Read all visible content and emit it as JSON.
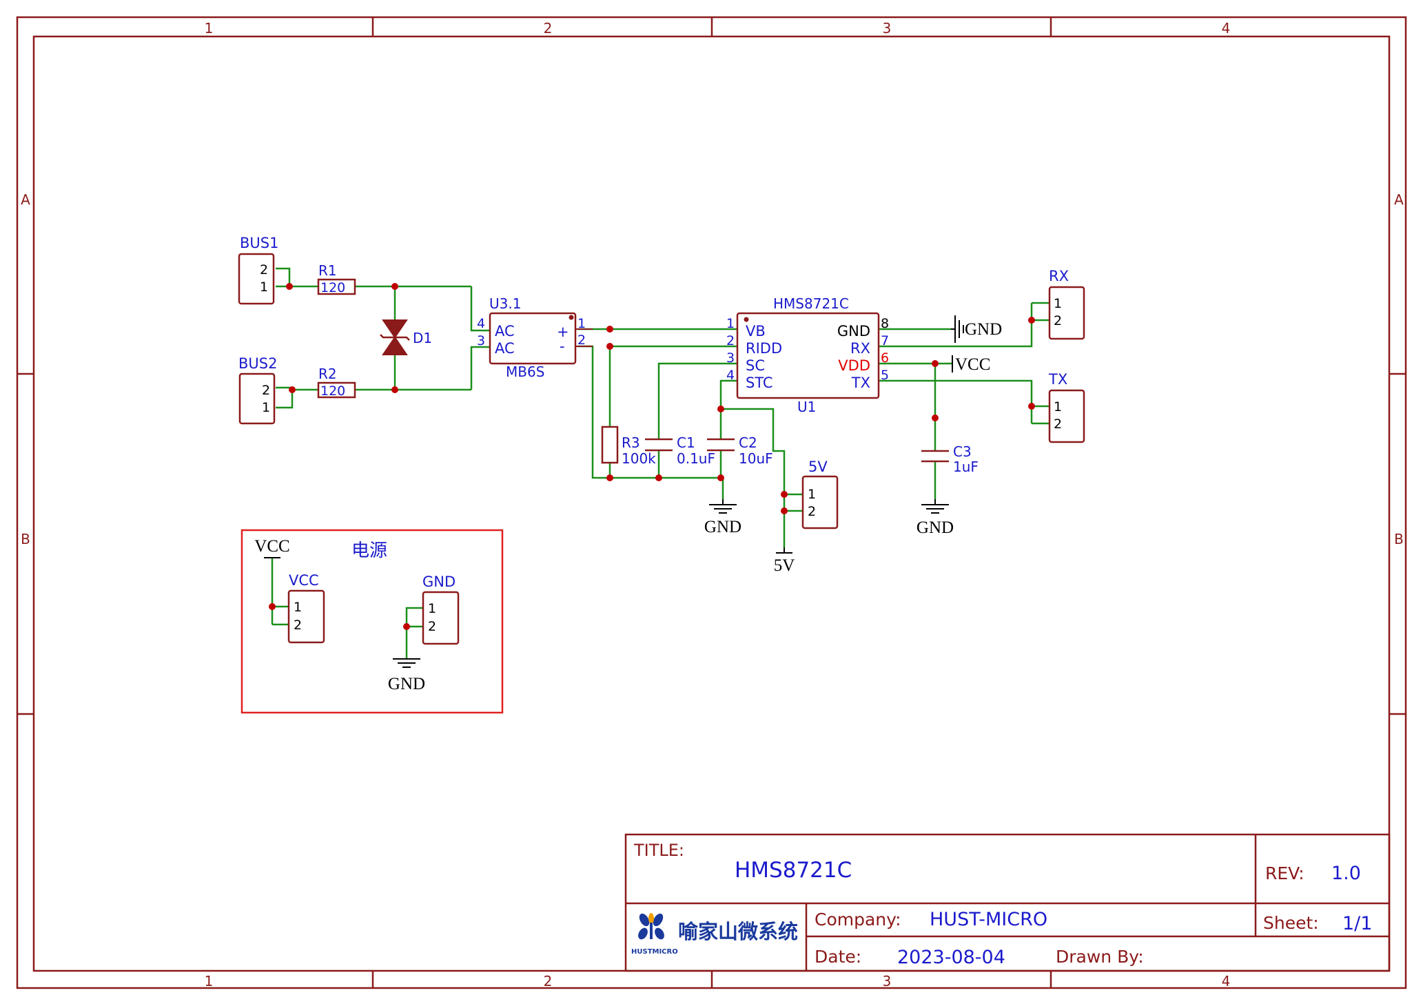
{
  "frame": {
    "columns": [
      "1",
      "2",
      "3",
      "4"
    ],
    "rows": [
      "A",
      "B"
    ],
    "border_color": "#8b1a1a"
  },
  "colors": {
    "wire": "#1a8f1a",
    "component": "#8b1a1a",
    "pin_text": "#1a1acc",
    "junction": "#c00000",
    "power_box": "#e02020",
    "vdd_pin": "#e00000",
    "black": "#000000"
  },
  "components": {
    "bus1": {
      "ref": "BUS1",
      "pins": [
        "2",
        "1"
      ]
    },
    "bus2": {
      "ref": "BUS2",
      "pins": [
        "2",
        "1"
      ]
    },
    "r1": {
      "ref": "R1",
      "value": "120"
    },
    "r2": {
      "ref": "R2",
      "value": "120"
    },
    "d1": {
      "ref": "D1"
    },
    "u3": {
      "ref": "U3.1",
      "value": "MB6S",
      "pins_left": [
        "4",
        "3"
      ],
      "pin_names_left": [
        "AC",
        "AC"
      ],
      "pins_right": [
        "1",
        "2"
      ],
      "pin_names_right": [
        "+",
        "-"
      ]
    },
    "u1": {
      "ref": "U1",
      "value": "HMS8721C",
      "left_pins": [
        {
          "num": "1",
          "name": "VB"
        },
        {
          "num": "2",
          "name": "RIDD"
        },
        {
          "num": "3",
          "name": "SC"
        },
        {
          "num": "4",
          "name": "STC"
        }
      ],
      "right_pins": [
        {
          "num": "8",
          "name": "GND"
        },
        {
          "num": "7",
          "name": "RX"
        },
        {
          "num": "6",
          "name": "VDD"
        },
        {
          "num": "5",
          "name": "TX"
        }
      ]
    },
    "r3": {
      "ref": "R3",
      "value": "100k"
    },
    "c1": {
      "ref": "C1",
      "value": "0.1uF"
    },
    "c2": {
      "ref": "C2",
      "value": "10uF"
    },
    "c3": {
      "ref": "C3",
      "value": "1uF"
    },
    "rx": {
      "ref": "RX",
      "pins": [
        "1",
        "2"
      ]
    },
    "tx": {
      "ref": "TX",
      "pins": [
        "1",
        "2"
      ]
    },
    "j5v": {
      "ref": "5V",
      "pins": [
        "1",
        "2"
      ]
    },
    "vcc_conn": {
      "ref": "VCC",
      "pins": [
        "1",
        "2"
      ]
    },
    "gnd_conn": {
      "ref": "GND",
      "pins": [
        "1",
        "2"
      ]
    }
  },
  "net_labels": {
    "gnd": "GND",
    "vcc": "VCC",
    "v5": "5V"
  },
  "power_box": {
    "title": "电源"
  },
  "title_block": {
    "title_label": "TITLE:",
    "title": "HMS8721C",
    "rev_label": "REV:",
    "rev": "1.0",
    "company_label": "Company:",
    "company": "HUST-MICRO",
    "sheet_label": "Sheet:",
    "sheet": "1/1",
    "date_label": "Date:",
    "date": "2023-08-04",
    "drawn_by_label": "Drawn By:",
    "logo_text": "喻家山微系统",
    "logo_sub": "HUSTMICRO"
  }
}
